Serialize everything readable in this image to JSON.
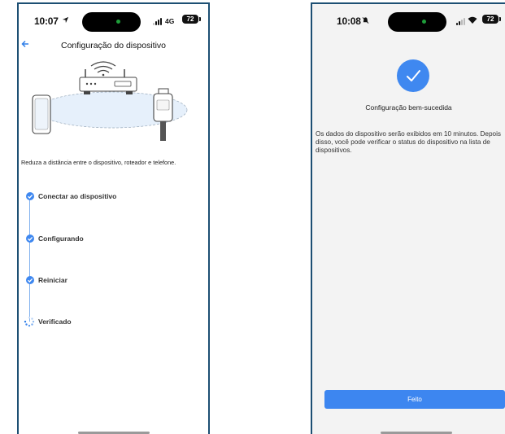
{
  "phone1": {
    "status": {
      "time": "10:07",
      "network": "4G",
      "battery": "72"
    },
    "title": "Configuração do dispositivo",
    "hint": "Reduza a distância entre o dispositivo, roteador e telefone.",
    "steps": [
      {
        "label": "Conectar ao dispositivo",
        "state": "done"
      },
      {
        "label": "Configurando",
        "state": "done"
      },
      {
        "label": "Reiniciar",
        "state": "done"
      },
      {
        "label": "Verificado",
        "state": "loading"
      }
    ],
    "icons": [
      "location-arrow-icon",
      "back-arrow-icon",
      "router-illustration",
      "phone-illustration",
      "sensor-illustration",
      "check-icon",
      "spinner-icon"
    ]
  },
  "phone2": {
    "status": {
      "time": "10:08",
      "battery": "72"
    },
    "title": "Configuração bem-sucedida",
    "description": "Os dados do dispositivo serão exibidos em 10 minutos. Depois disso, você pode verificar o status do dispositivo na lista de dispositivos.",
    "done_label": "Feito",
    "icons": [
      "bell-slash-icon",
      "wifi-icon",
      "success-check-icon"
    ]
  },
  "colors": {
    "accent": "#3f88f0",
    "frame": "#1d4f73",
    "success_bg": "#f3f3f3"
  }
}
